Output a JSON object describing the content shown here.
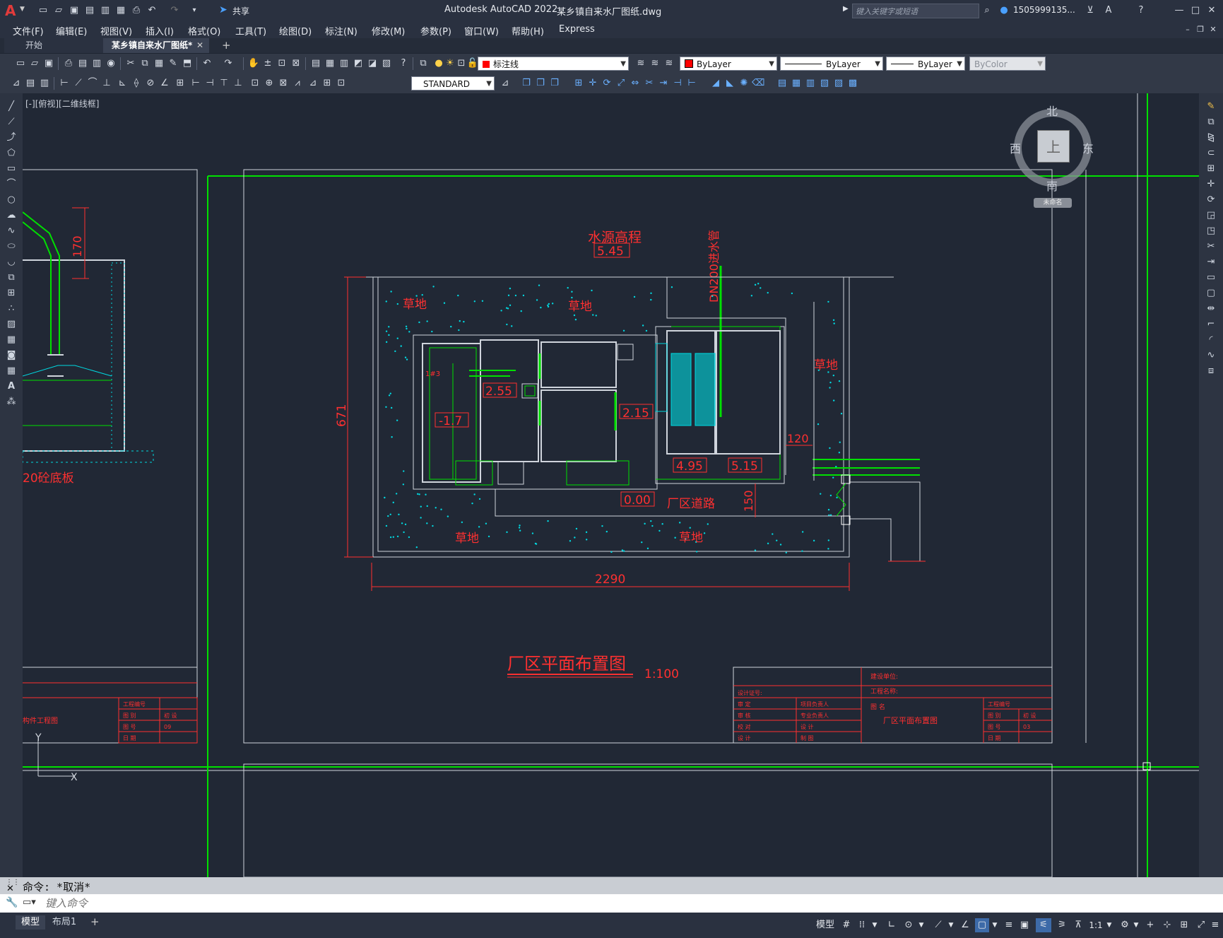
{
  "titlebar": {
    "app_title": "Autodesk AutoCAD 2022",
    "file_title": "某乡镇自来水厂图纸.dwg",
    "share_label": "共享",
    "search_placeholder": "键入关键字或短语",
    "user_name": "1505999135...",
    "app_icon": "A"
  },
  "menu": [
    "文件(F)",
    "编辑(E)",
    "视图(V)",
    "插入(I)",
    "格式(O)",
    "工具(T)",
    "绘图(D)",
    "标注(N)",
    "修改(M)",
    "参数(P)",
    "窗口(W)",
    "帮助(H)",
    "Express"
  ],
  "tabs": [
    {
      "label": "开始",
      "active": false
    },
    {
      "label": "某乡镇自来水厂图纸*",
      "active": true
    }
  ],
  "layer_toolbar": {
    "layer_name": "标注线",
    "color": "ByLayer",
    "linetype": "ByLayer",
    "lineweight": "ByLayer",
    "plotstyle": "ByColor",
    "text_style": "STANDARD"
  },
  "viewport_label": "[-][俯视][二维线框]",
  "viewcube": {
    "north": "北",
    "south": "南",
    "east": "东",
    "west": "西",
    "face": "上",
    "wcs": "未命名"
  },
  "drawing": {
    "elevation_title": "水源高程",
    "elevation_value": "5.45",
    "inlet_label": "DN200进水管",
    "grass": [
      "草地",
      "草地",
      "草地",
      "草地",
      "草地"
    ],
    "levels": [
      "2.55",
      "-1.7",
      "2.15",
      "4.95",
      "5.15",
      "0.00"
    ],
    "road_label": "厂区道路",
    "dim_height": "671",
    "dim_width": "2290",
    "dim_120": "120",
    "dim_150": "150",
    "dim_170": "170",
    "left_note": "20砼底板",
    "main_title": "厂区平面布置图",
    "scale": "1:100",
    "room_label": "1#3",
    "left_tb_name": "构件工程图",
    "left_tb_cells": [
      "工程编号",
      "图 别",
      "初 设",
      "图 号",
      "09",
      "日 期"
    ],
    "tb_unit": "建设单位:",
    "tb_project": "工程名称:",
    "tb_cert": "设计证号:",
    "tb_rows": [
      "审 定",
      "审 核",
      "校 对",
      "设 计"
    ],
    "tb_roles": [
      "项目负责人",
      "专业负责人",
      "设 计",
      "制 图"
    ],
    "tb_figure_label": "图 名",
    "tb_figure_name": "厂区平面布置图",
    "tb_right_cells": [
      "工程编号",
      "图 别",
      "初 设",
      "图 号",
      "03",
      "日 期"
    ]
  },
  "command": {
    "history": "命令: *取消*",
    "placeholder": "键入命令"
  },
  "layout_tabs": [
    "模型",
    "布局1"
  ],
  "status": {
    "model": "模型",
    "scale": "1:1"
  }
}
